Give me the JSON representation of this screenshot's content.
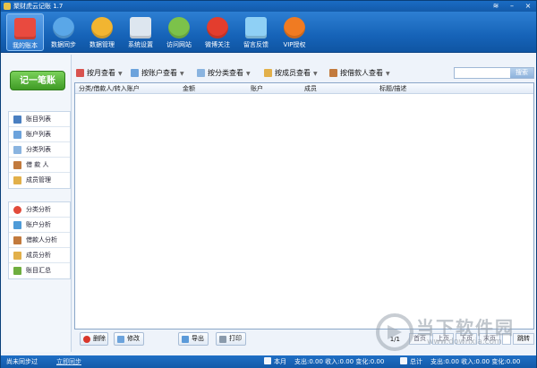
{
  "window": {
    "title": "聚财虎云记账 1.7",
    "controls": [
      "wifi-icon",
      "minimize-icon",
      "close-icon"
    ]
  },
  "toolbar": [
    {
      "label": "我的账本",
      "icon": "book-icon",
      "color": "#e94a3f",
      "active": true
    },
    {
      "label": "数据同步",
      "icon": "sync-icon",
      "color": "#5aa7e8"
    },
    {
      "label": "数据管理",
      "icon": "database-icon",
      "color": "#f2b531"
    },
    {
      "label": "系统设置",
      "icon": "gear-icon",
      "color": "#dde6ef"
    },
    {
      "label": "访问网站",
      "icon": "globe-icon",
      "color": "#7cc24a"
    },
    {
      "label": "微博关注",
      "icon": "weibo-icon",
      "color": "#e33d2e"
    },
    {
      "label": "留言反馈",
      "icon": "message-icon",
      "color": "#8fd0f5"
    },
    {
      "label": "VIP授权",
      "icon": "yen-icon",
      "color": "#f07b22"
    }
  ],
  "sidebar": {
    "new_entry": "记一笔账",
    "group1": [
      {
        "label": "账目列表",
        "icon": "list-icon",
        "color": "#4a7fc1"
      },
      {
        "label": "账户列表",
        "icon": "account-icon",
        "color": "#6ca3dc"
      },
      {
        "label": "分类列表",
        "icon": "category-icon",
        "color": "#8ab4e0"
      },
      {
        "label": "借 款 人",
        "icon": "borrower-icon",
        "color": "#c27a3d"
      },
      {
        "label": "成员管理",
        "icon": "member-icon",
        "color": "#e2b04a"
      }
    ],
    "group2": [
      {
        "label": "分类分析",
        "icon": "pie-chart-icon",
        "color": "#e24b3b"
      },
      {
        "label": "账户分析",
        "icon": "account-analysis-icon",
        "color": "#4e9bd8"
      },
      {
        "label": "借款人分析",
        "icon": "borrower-analysis-icon",
        "color": "#c27a3d"
      },
      {
        "label": "成员分析",
        "icon": "member-analysis-icon",
        "color": "#e2b04a"
      },
      {
        "label": "账目汇总",
        "icon": "summary-icon",
        "color": "#6fae3f"
      }
    ]
  },
  "filters": [
    {
      "label": "按月查看",
      "icon": "calendar-icon",
      "color": "#d9534f"
    },
    {
      "label": "按账户查看",
      "icon": "account-icon",
      "color": "#6ca3dc"
    },
    {
      "label": "按分类查看",
      "icon": "category-icon",
      "color": "#8ab4e0"
    },
    {
      "label": "按成员查看",
      "icon": "member-icon",
      "color": "#e2b04a"
    },
    {
      "label": "按借款人查看",
      "icon": "borrower-icon",
      "color": "#c27a3d"
    }
  ],
  "search": {
    "button": "搜索",
    "value": ""
  },
  "table": {
    "columns": [
      "分类/借款人/转入账户",
      "金额",
      "账户",
      "成员",
      "标题/描述"
    ],
    "rows": []
  },
  "actions": {
    "delete": "删除",
    "edit": "修改",
    "export": "导出",
    "print": "打印"
  },
  "pager": {
    "page": "1/1",
    "first": "首页",
    "prev": "上页",
    "next": "下页",
    "last": "末页",
    "jump": "跳转"
  },
  "statusbar": {
    "sync_status": "尚未同步过",
    "sync_now": "立即同步",
    "month_label": "本月",
    "month_stats": "支出:0.00 收入:0.00 变化:0.00",
    "total_label": "总计",
    "total_stats": "支出:0.00 收入:0.00 变化:0.00"
  },
  "watermark": {
    "text": "当下软件园",
    "url": "www.downxia.com"
  }
}
